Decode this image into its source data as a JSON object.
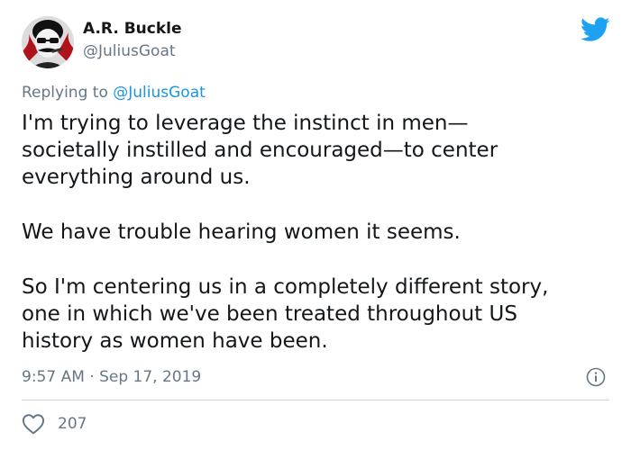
{
  "tweet": {
    "author": {
      "display_name": "A.R. Buckle",
      "handle": "@JuliusGoat"
    },
    "reply": {
      "prefix": "Replying to ",
      "handle": "@JuliusGoat"
    },
    "paragraphs": [
      "I'm trying to leverage the instinct in men—\nsocietally instilled and encouraged—to center\neverything around us.",
      "We have trouble hearing women it seems.",
      "So I'm centering us in a completely different story,\none in which we've been treated throughout US\nhistory as women have been."
    ],
    "timestamp": "9:57 AM · Sep 17, 2019",
    "likes": "207"
  },
  "icons": {
    "brand": "twitter-bird-icon",
    "info": "info-icon",
    "like": "heart-icon"
  },
  "colors": {
    "brand_blue": "#1da1f2",
    "link_blue": "#1b95e0",
    "secondary_text": "#657786",
    "primary_text": "#14171a",
    "divider": "#ccd6dd"
  }
}
